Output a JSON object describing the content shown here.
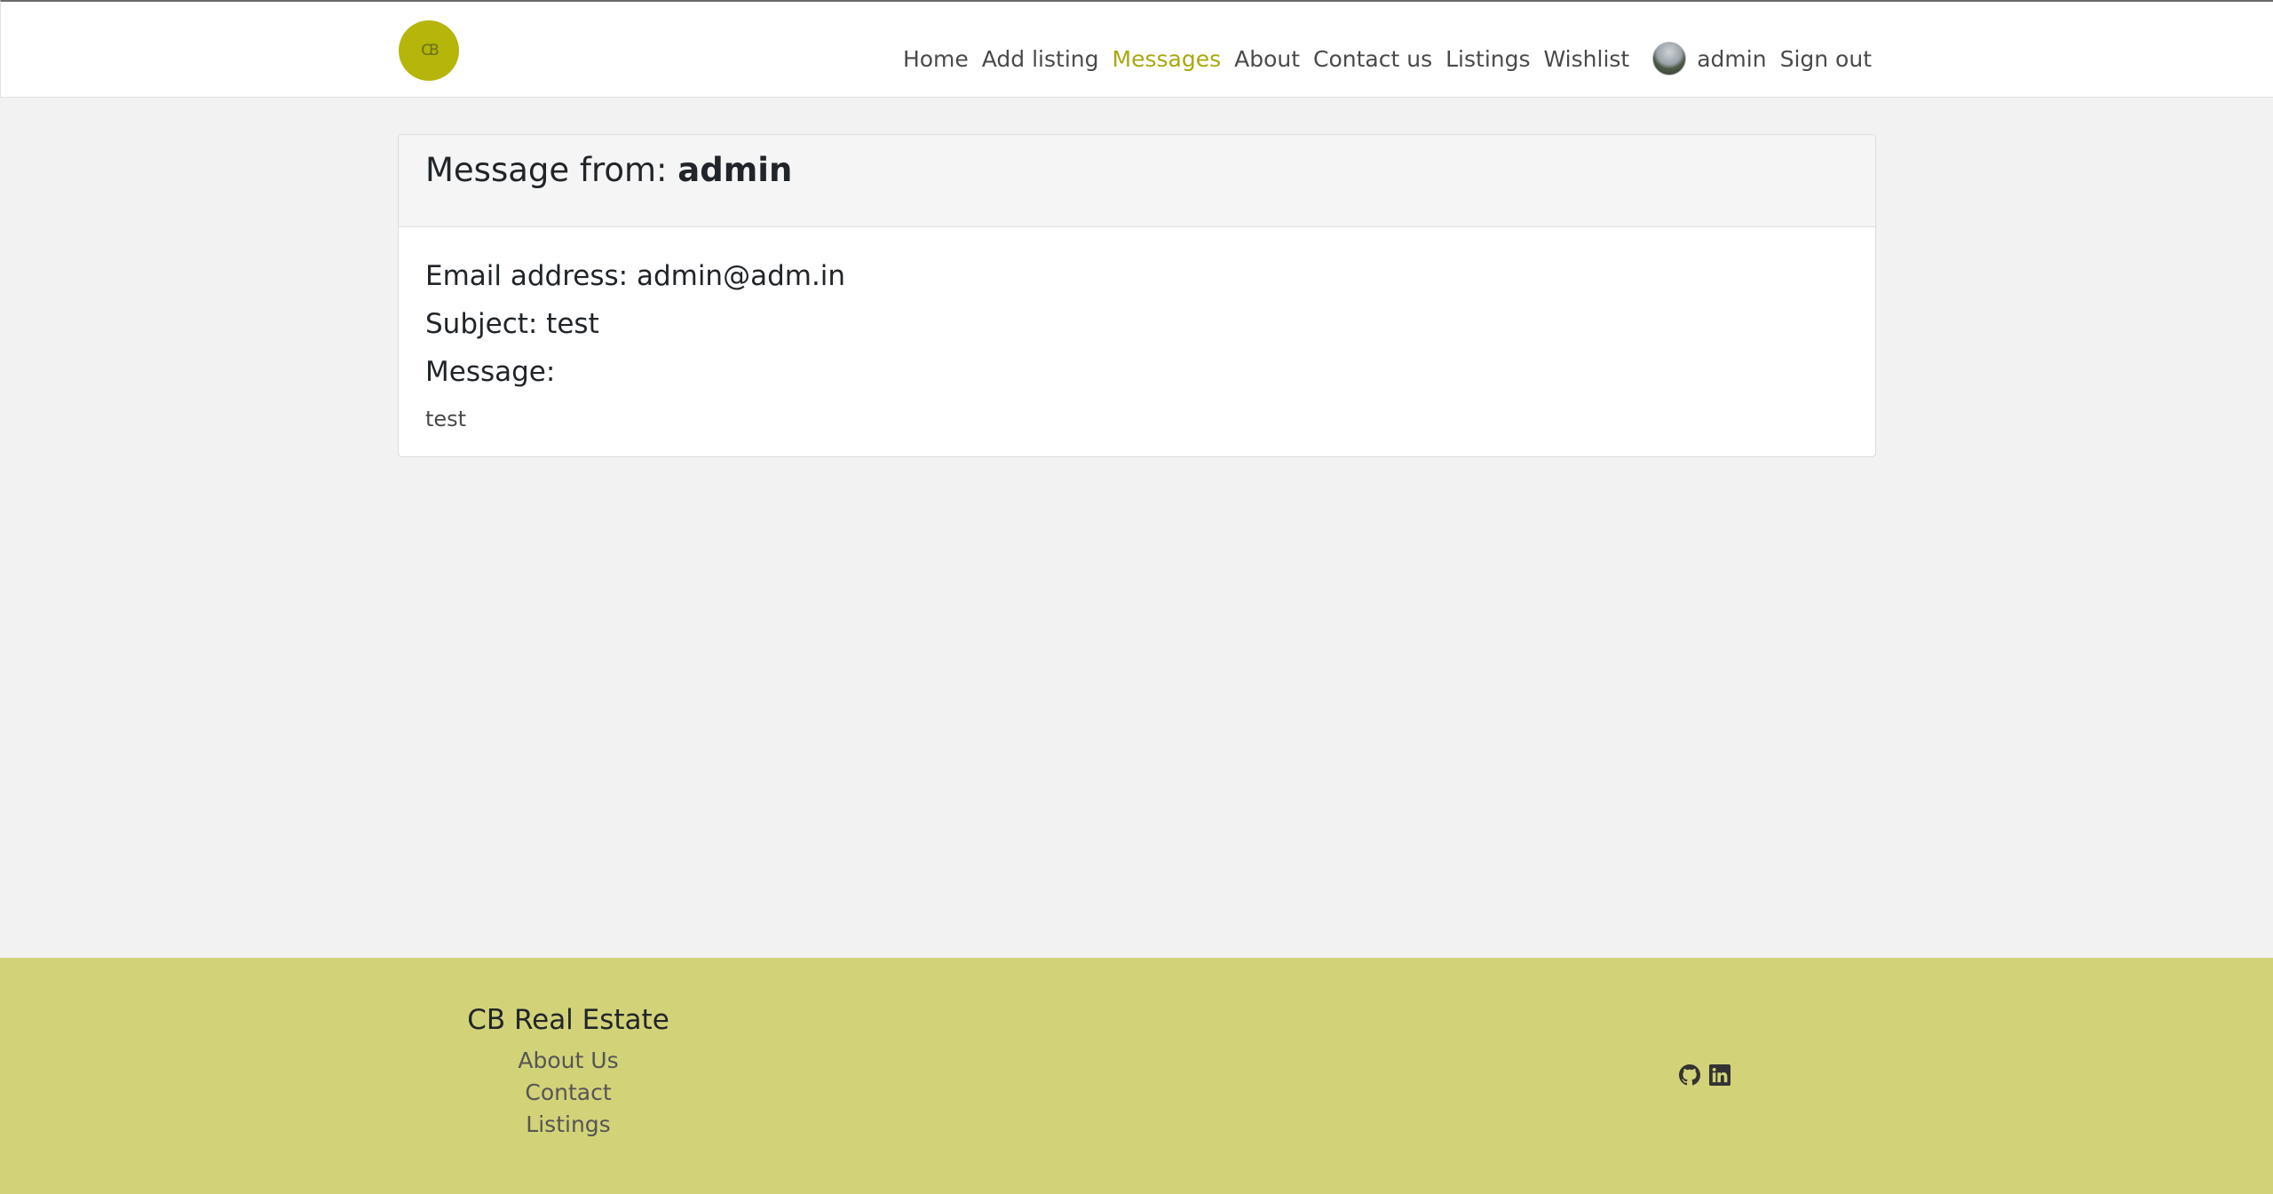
{
  "nav": {
    "brand_text": "CB",
    "links": [
      "Home",
      "Add listing",
      "Messages",
      "About",
      "Contact us",
      "Listings",
      "Wishlist"
    ],
    "active": "Messages",
    "user_name": "admin",
    "sign_out": "Sign out"
  },
  "message": {
    "header_prefix": "Message from:",
    "sender": "admin",
    "email_line": "Email address: admin@adm.in",
    "subject_line": "Subject: test",
    "message_label": "Message:",
    "body": "test"
  },
  "footer": {
    "title": "CB Real Estate",
    "links": [
      "About Us",
      "Contact",
      "Listings"
    ],
    "icons": [
      "github-icon",
      "linkedin-icon"
    ]
  },
  "colors": {
    "accent": "#a8a810",
    "brand_circle": "#b5b50a",
    "footer_bg": "#d2d279",
    "page_bg": "#f2f2f2"
  }
}
